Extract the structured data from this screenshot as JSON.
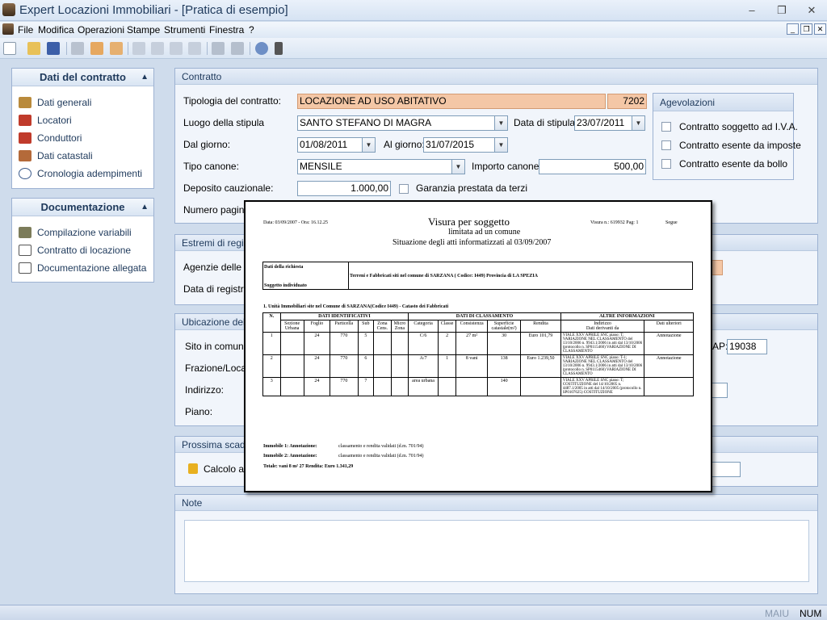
{
  "window": {
    "title": "Expert Locazioni Immobiliari - [Pratica di esempio]",
    "minimize": "–",
    "restore": "❐",
    "close": "✕"
  },
  "menu": [
    "File",
    "Modifica",
    "Operazioni",
    "Stampe",
    "Strumenti",
    "Finestra",
    "?"
  ],
  "mdi": {
    "minimize": "_",
    "restore": "❐",
    "close": "✕"
  },
  "sidebar": {
    "contract_title": "Dati del contratto",
    "contract_items": [
      "Dati generali",
      "Locatori",
      "Conduttori",
      "Dati catastali",
      "Cronologia adempimenti"
    ],
    "docs_title": "Documentazione",
    "docs_items": [
      "Compilazione variabili",
      "Contratto di locazione",
      "Documentazione allegata"
    ]
  },
  "contratto": {
    "header": "Contratto",
    "tipologia_label": "Tipologia del contratto:",
    "tipologia_value": "LOCAZIONE AD USO ABITATIVO",
    "tipologia_code": "7202",
    "luogo_label": "Luogo della stipula",
    "luogo_value": "SANTO STEFANO DI MAGRA",
    "data_stipula_label": "Data di stipula:",
    "data_stipula_value": "23/07/2011",
    "dal_label": "Dal giorno:",
    "dal_value": "01/08/2011",
    "al_label": "Al giorno:",
    "al_value": "31/07/2015",
    "tipo_canone_label": "Tipo canone:",
    "tipo_canone_value": "MENSILE",
    "importo_label": "Importo canone:",
    "importo_value": "500,00",
    "deposito_label": "Deposito cauzionale:",
    "deposito_value": "1.000,00",
    "garanzia_label": "Garanzia prestata da terzi",
    "pagine_label": "Numero pagine"
  },
  "agevolazioni": {
    "header": "Agevolazioni",
    "items": [
      "Contratto soggetto ad I.V.A.",
      "Contratto esente da imposte",
      "Contratto esente da bollo"
    ]
  },
  "estremi": {
    "header": "Estremi di registr",
    "agenzie_label": "Agenzie delle en",
    "data_label": "Data di registraz"
  },
  "ubicazione": {
    "header": "Ubicazione dell'i",
    "sito_label": "Sito in comune",
    "cap_label": "AP:",
    "cap_value": "19038",
    "frazione_label": "Frazione/Locali",
    "indirizzo_label": "Indirizzo:",
    "piano_label": "Piano:"
  },
  "scadenza": {
    "header": "Prossima scaden",
    "calcolo_label": "Calcolo au"
  },
  "notes": {
    "header": "Note"
  },
  "status": {
    "maiu": "MAIU",
    "num": "NUM"
  },
  "visura": {
    "date_line": "Data: 03/09/2007 - Ora: 16.12.25",
    "title": "Visura per soggetto",
    "subtitle1": "limitata ad un comune",
    "subtitle2": "Situazione degli atti informatizzati al 03/09/2007",
    "visura_no": "Visura n.: 619932  Pag: 1",
    "segue": "Segue",
    "richiesta_label": "Dati della richiesta",
    "richiesta_value": "Terreni e Fabbricati siti nel comune di SARZANA ( Codice: I449) Provincia di LA SPEZIA",
    "soggetto_label": "Soggetto individuato",
    "section_title": "1. Unità Immobiliari site nel Comune di SARZANA(Codice I449) - Catasto dei Fabbricati",
    "group_headers": [
      "N.",
      "DATI IDENTIFICATIVI",
      "DATI DI CLASSAMENTO",
      "ALTRE INFORMAZIONI"
    ],
    "col_headers": [
      "Sezione Urbana",
      "Foglio",
      "Particella",
      "Sub",
      "Zona Cens.",
      "Micro Zona",
      "Categoria",
      "Classe",
      "Consistenza",
      "Superficie catastale(m²)",
      "Rendita",
      "Indirizzo",
      "Dati ulteriori"
    ],
    "col_sub_right": "Dati derivanti da",
    "rows": [
      {
        "n": "1",
        "sez": "",
        "foglio": "24",
        "part": "770",
        "sub": "5",
        "zona": "",
        "micro": "",
        "cat": "C/6",
        "classe": "2",
        "cons": "27 m²",
        "sup": "30",
        "rendita": "Euro 101,79",
        "ind": "VIALE XXV APRILE SNC piano: T; VARIAZIONE NEL CLASSAMENTO del 13/10/2006 n. 9943.1/2006 in atti dal 13/10/2006 (protocollo n. SP0115460) VARIAZIONE DI CLASSAMENTO",
        "ult": "Annotazione"
      },
      {
        "n": "2",
        "sez": "",
        "foglio": "24",
        "part": "770",
        "sub": "6",
        "zona": "",
        "micro": "",
        "cat": "A/7",
        "classe": "1",
        "cons": "8 vani",
        "sup": "138",
        "rendita": "Euro 1.239,50",
        "ind": "VIALE XXV APRILE SNC piano: T-1; VARIAZIONE NEL CLASSAMENTO del 13/10/2006 n. 9943.1/2006 in atti dal 13/10/2006 (protocollo n. SP0115460) VARIAZIONE DI CLASSAMENTO",
        "ult": "Annotazione"
      },
      {
        "n": "3",
        "sez": "",
        "foglio": "24",
        "part": "770",
        "sub": "7",
        "zona": "",
        "micro": "",
        "cat": "area urbana",
        "classe": "",
        "cons": "",
        "sup": "140",
        "rendita": "",
        "ind": "VIALE XXV APRILE SNC piano: T; COSTITUZIONE del 14/10/2005 n. 4487.1/2005 in atti dal 14/10/2005 (protocollo n. SP0107625) COSTITUZIONE",
        "ult": ""
      }
    ],
    "annot1_label": "Immobile 1: Annotazione:",
    "annot1_value": "classamento e rendita validati (d.m. 701/94)",
    "annot2_label": "Immobile 2: Annotazione:",
    "annot2_value": "classamento e rendita validati (d.m. 701/94)",
    "totale": "Totale: vani 8   m² 27     Rendita: Euro 1.341,29"
  }
}
